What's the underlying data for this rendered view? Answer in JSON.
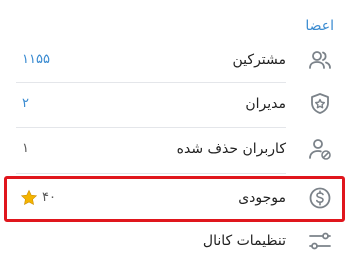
{
  "section": {
    "title": "اعضا"
  },
  "rows": [
    {
      "label": "مشترکین",
      "value": "۱۱۵۵",
      "icon": "users-icon"
    },
    {
      "label": "مدیران",
      "value": "۲",
      "icon": "admin-shield-icon"
    },
    {
      "label": "کاربران حذف شده",
      "value": "۱",
      "icon": "removed-user-icon"
    },
    {
      "label": "موجودی",
      "value": "۴۰",
      "icon": "dollar-circle-icon",
      "value_icon": "star-icon"
    },
    {
      "label": "تنظیمات کانال",
      "icon": "sliders-icon"
    }
  ],
  "colors": {
    "accent": "#3a8bd1",
    "highlight": "#e0161d",
    "icon": "#7b8289",
    "star": "#f4b400"
  }
}
